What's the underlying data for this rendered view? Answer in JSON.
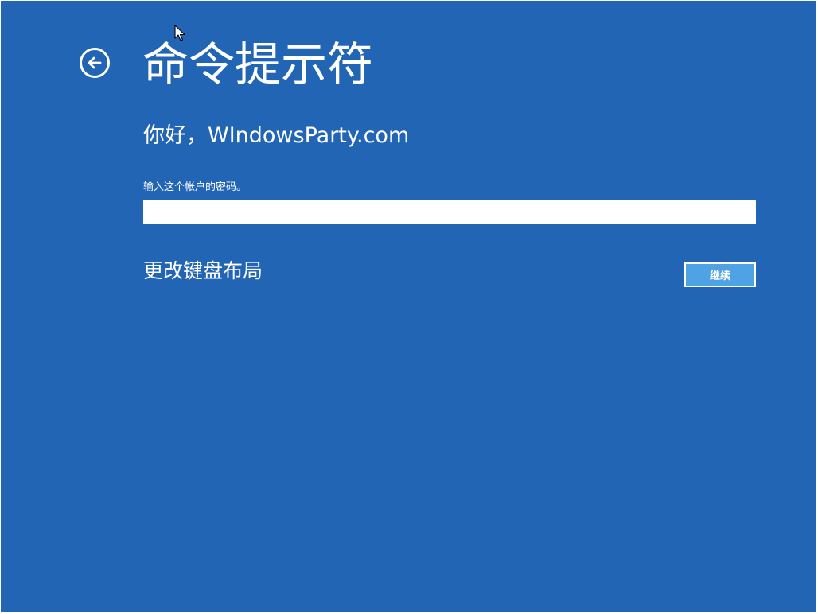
{
  "page": {
    "title": "命令提示符",
    "greeting": "你好，WIndowsParty.com"
  },
  "form": {
    "password_label": "输入这个帐户的密码。",
    "password_value": "",
    "keyboard_layout_link": "更改键盘布局",
    "continue_label": "继续"
  },
  "icons": {
    "back": "back-arrow-icon",
    "cursor": "mouse-pointer-icon"
  },
  "colors": {
    "background": "#2265b4",
    "button": "#4fa2e4",
    "text": "#ffffff"
  }
}
